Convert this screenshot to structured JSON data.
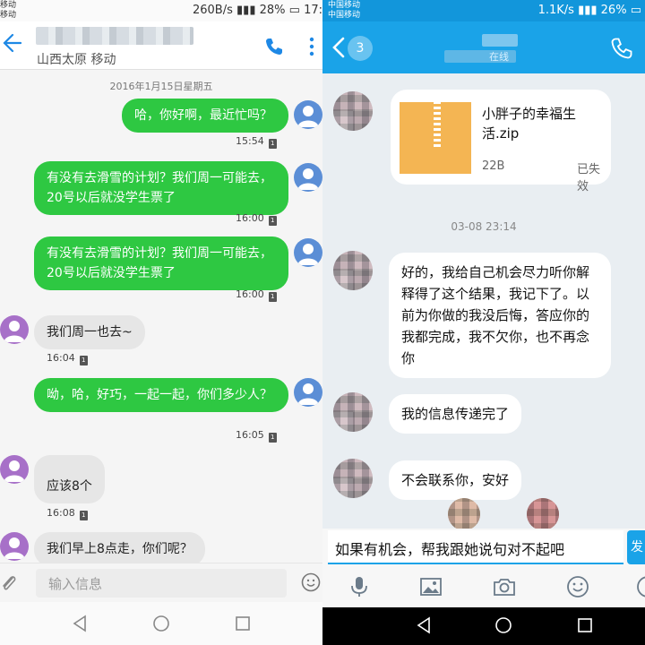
{
  "left": {
    "statusbar": {
      "carrier_line1": "移动",
      "carrier_line2": "移动",
      "speed": "260B/s",
      "battery": "28%",
      "clock": "17:"
    },
    "appbar": {
      "subtitle": "山西太原 移动"
    },
    "date_header": "2016年1月15日星期五",
    "messages": [
      {
        "side": "out",
        "text": "哈，你好啊，最近忙吗？",
        "time": "15:54"
      },
      {
        "side": "out",
        "text": "有没有去滑雪的计划？我们周一可能去，20号以后就没学生票了",
        "time": "16:00"
      },
      {
        "side": "out",
        "text": "有没有去滑雪的计划？我们周一可能去，20号以后就没学生票了",
        "time": "16:00"
      },
      {
        "side": "in",
        "text": "我们周一也去~",
        "time": "16:04"
      },
      {
        "side": "out",
        "text": "呦，哈，好巧，一起一起，你们多少人？",
        "time": "16:05"
      },
      {
        "side": "in",
        "text": "应该8个",
        "time": "16:08"
      },
      {
        "side": "in",
        "text": "我们早上8点走，你们呢？",
        "time": ""
      }
    ],
    "sim_label": "1",
    "input": {
      "placeholder": "输入信息"
    }
  },
  "right": {
    "statusbar": {
      "carrier_line1": "中国移动",
      "carrier_line2": "中国移动",
      "speed": "1.1K/s",
      "battery": "26%"
    },
    "appbar": {
      "unread_count": "3",
      "online_label": "在线"
    },
    "file": {
      "name": "小胖子的幸福生活.zip",
      "size": "22B",
      "status": "已失效"
    },
    "time_divider": "03-08 23:14",
    "messages": [
      {
        "text": "好的，我给自己机会尽力听你解释得了这个结果，我记下了。以前为你做的我没后悔，答应你的我都完成，我不欠你，也不再念你"
      },
      {
        "text": "我的信息传递完了"
      },
      {
        "text": "不会联系你，安好"
      }
    ],
    "input_value": "如果有机会，帮我跟她说句对不起吧",
    "send_label": "发",
    "toolbar": [
      "microphone-icon",
      "image-icon",
      "camera-icon",
      "emoji-icon",
      "more-icon"
    ]
  },
  "colors": {
    "sms_out": "#2ec842",
    "qq_blue": "#1aa3e8"
  }
}
